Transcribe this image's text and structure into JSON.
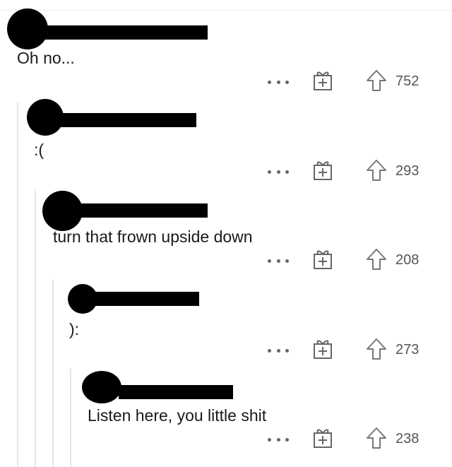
{
  "comments": [
    {
      "text": "Oh no...",
      "score": "752"
    },
    {
      "text": ":(",
      "score": "293"
    },
    {
      "text": "turn that frown upside down",
      "score": "208"
    },
    {
      "text": "):",
      "score": "273"
    },
    {
      "text": "Listen here, you little shit",
      "score": "238"
    }
  ],
  "icons": {
    "more": "more-icon",
    "award": "gift-icon",
    "upvote": "upvote-arrow-icon"
  },
  "colors": {
    "icon_gray": "#666666",
    "thread_line": "#e6e6e6",
    "redaction": "#000000"
  }
}
